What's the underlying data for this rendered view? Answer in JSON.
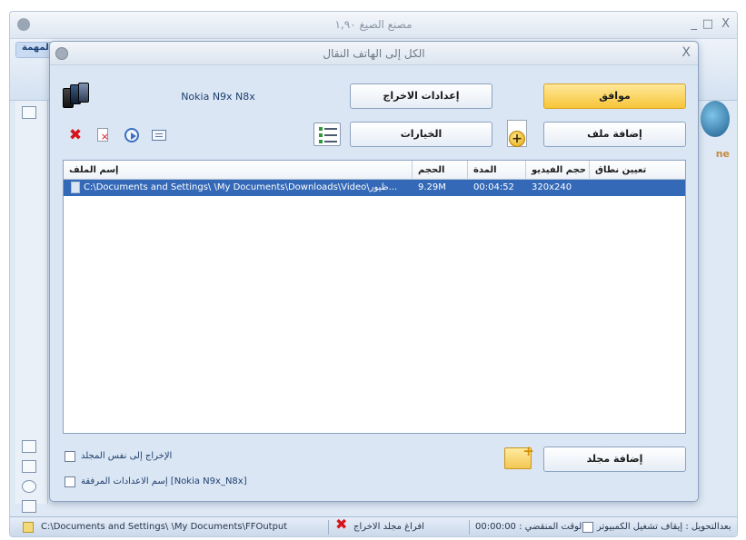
{
  "background_window": {
    "title": "مصنع الصيغ ١,٩٠",
    "ribbon_tab": "المهمة",
    "minimize": "_",
    "maximize": "□",
    "close": "X",
    "brand_fragment": "ne"
  },
  "dialog": {
    "title": "الكل إلى الهاتف النقال",
    "close": "X",
    "device_label": "Nokia N9x  N8x",
    "buttons": {
      "ok": "موافق",
      "output_settings": "إعدادات الاخراج",
      "options": "الخيارات",
      "add_file": "إضافة ملف",
      "add_folder": "إضافة مجلد"
    },
    "toolbar_icons": [
      "delete-icon",
      "remove-file-icon",
      "play-icon",
      "media-info-icon"
    ],
    "table": {
      "columns": {
        "filename": "إسم الملف",
        "size": "الحجم",
        "duration": "المدة",
        "video_size": "حجم الفيديو",
        "range": "تعيين نطاق"
      },
      "rows": [
        {
          "filename": "C:\\Documents and Settings\\        \\My Documents\\Downloads\\Video\\ظيور...",
          "size": "9.29M",
          "duration": "00:04:52",
          "video_size": "320x240",
          "range": ""
        }
      ]
    },
    "checkboxes": {
      "output_same_folder": "الإخراج إلى نفس المجلد",
      "attached_settings_name": "إسم الاعدادات المرفقة [Nokia N9x_N8x]"
    }
  },
  "status_bar": {
    "output_path": "C:\\Documents and Settings\\        \\My Documents\\FFOutput",
    "empty_output_folder": "افراغ مجلد الاخراج",
    "elapsed": "00:00:00 : الوقت المنقضي",
    "after_convert": "بعدالتحويل : إيقاف تشغيل الكمبيوتر"
  },
  "colors": {
    "dialog_bg": "#dae6f4",
    "selection": "#3469b8",
    "ok_button": "#f7c538",
    "delete_red": "#d5151c"
  }
}
